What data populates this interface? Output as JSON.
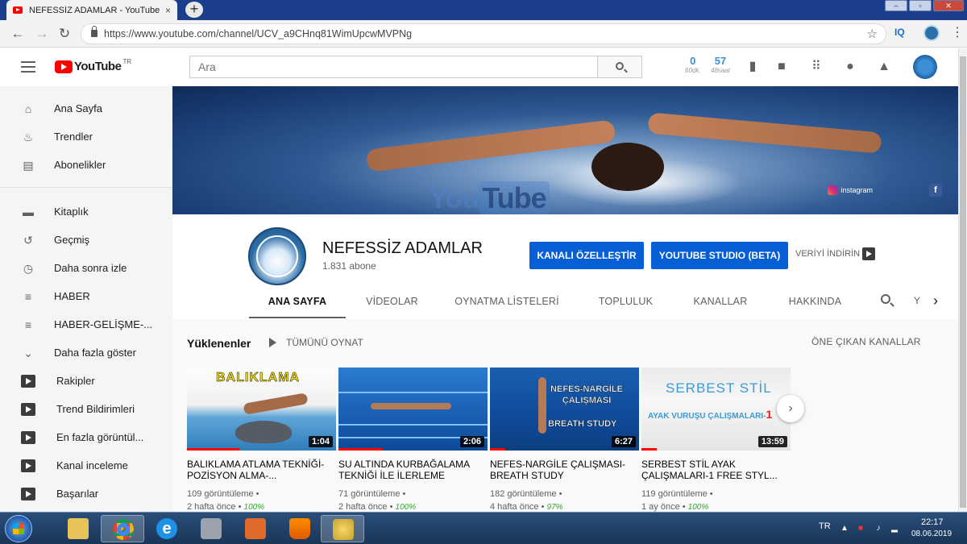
{
  "browser": {
    "tab_title": "NEFESSİZ ADAMLAR - YouTube",
    "tab_close": "×",
    "new_tab": "+",
    "url": "https://www.youtube.com/channel/UCV_a9CHnq81WimUpcwMVPNg",
    "ext_iq": "IQ",
    "icons": [
      "back-icon",
      "forward-icon",
      "reload-icon",
      "lock-icon",
      "star-icon",
      "menu-icon"
    ]
  },
  "masthead": {
    "logo_text": "YouTube",
    "region": "TR",
    "search_placeholder": "Ara",
    "stat1_value": "0",
    "stat1_sub": "60dk.",
    "stat2_value": "57",
    "stat2_sub": "48saat"
  },
  "sidebar": {
    "main": [
      {
        "label": "Ana Sayfa",
        "icon": "home-icon"
      },
      {
        "label": "Trendler",
        "icon": "fire-icon"
      },
      {
        "label": "Abonelikler",
        "icon": "subscriptions-icon"
      }
    ],
    "library": [
      {
        "label": "Kitaplık",
        "icon": "folder-icon"
      },
      {
        "label": "Geçmiş",
        "icon": "history-icon"
      },
      {
        "label": "Daha sonra izle",
        "icon": "clock-icon"
      },
      {
        "label": "HABER",
        "icon": "playlist-icon"
      },
      {
        "label": "HABER-GELİŞME-...",
        "icon": "playlist-icon"
      },
      {
        "label": "Daha fazla göster",
        "icon": "chevron-down-icon"
      }
    ],
    "subscriptions": [
      {
        "label": "Rakipler"
      },
      {
        "label": "Trend Bildirimleri"
      },
      {
        "label": "En fazla görüntül..."
      },
      {
        "label": "Kanal inceleme"
      },
      {
        "label": "Başarılar"
      }
    ]
  },
  "banner": {
    "watermark_you": "You",
    "watermark_tube": "Tube",
    "instagram_label": "instagram",
    "facebook_label": "f"
  },
  "channel": {
    "name": "NEFESSİZ ADAMLAR",
    "subscribers": "1.831 abone",
    "customize_label": "KANALI ÖZELLEŞTİR",
    "studio_label": "YOUTUBE STUDIO (BETA)",
    "download_label": "VERİYİ İNDİRİN",
    "tabs": [
      "ANA SAYFA",
      "VİDEOLAR",
      "OYNATMA LİSTELERİ",
      "TOPLULUK",
      "KANALLAR",
      "HAKKINDA"
    ],
    "tab_overflow": "Y",
    "active_tab": "ANA SAYFA"
  },
  "uploads": {
    "title": "Yüklenenler",
    "play_all": "TÜMÜNÜ OYNAT",
    "featured_channels": "ÖNE ÇIKAN KANALLAR",
    "videos": [
      {
        "thumb_caption": "BALIKLAMA",
        "duration": "1:04",
        "title": "BALIKLAMA ATLAMA TEKNİĞİ- POZİSYON ALMA-...",
        "views": "109 görüntüleme •",
        "age": "2 hafta önce •",
        "rating": "100%",
        "watched": 0.35
      },
      {
        "thumb_caption": "",
        "duration": "2:06",
        "title": "SU ALTINDA KURBAĞALAMA TEKNİĞİ İLE İLERLEME",
        "views": "71 görüntüleme •",
        "age": "2 hafta önce •",
        "rating": "100%",
        "watched": 0.3
      },
      {
        "thumb_caption": "NEFES-NARGİLE ÇALIŞMASI",
        "thumb_caption_2": "BREATH STUDY",
        "duration": "6:27",
        "title": "NEFES-NARGİLE ÇALIŞMASI-BREATH STUDY",
        "views": "182 görüntüleme •",
        "age": "4 hafta önce •",
        "rating": "97%",
        "watched": 0.1
      },
      {
        "thumb_caption": "SERBEST STİL",
        "thumb_caption_2": "AYAK VURUŞU ÇALIŞMALARI-",
        "thumb_caption_num": "1",
        "duration": "13:59",
        "title": "SERBEST STİL AYAK ÇALIŞMALARI-1 FREE STYL...",
        "views": "119 görüntüleme •",
        "age": "1 ay önce •",
        "rating": "100%",
        "watched": 0.1
      }
    ]
  },
  "taskbar": {
    "lang": "TR",
    "time": "22:17",
    "date": "08.06.2019"
  },
  "colors": {
    "youtube_red": "#ff0000",
    "button_blue": "#065fd4",
    "rating_green": "#35a835",
    "stat_blue": "#3a8fd6"
  }
}
